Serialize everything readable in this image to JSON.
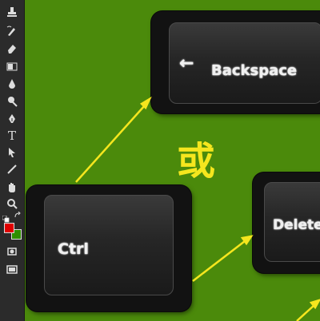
{
  "toolbar": {
    "tools": [
      {
        "icon": "stamp-icon"
      },
      {
        "icon": "history-brush-icon"
      },
      {
        "icon": "eraser-icon"
      },
      {
        "icon": "gradient-icon"
      },
      {
        "icon": "blur-icon"
      },
      {
        "icon": "dodge-icon"
      },
      {
        "icon": "pen-icon"
      },
      {
        "icon": "type-icon",
        "glyph": "T"
      },
      {
        "icon": "path-select-icon"
      },
      {
        "icon": "line-icon"
      },
      {
        "icon": "hand-icon"
      },
      {
        "icon": "zoom-icon"
      }
    ],
    "foreground_color": "#e00000",
    "background_color": "#2f8f00"
  },
  "canvas": {
    "background_color": "#4b8a0b",
    "keys": [
      {
        "name": "backspace",
        "label": "Backspace",
        "arrow_glyph": "←"
      },
      {
        "name": "ctrl",
        "label": "Ctrl"
      },
      {
        "name": "delete",
        "label": "Delete"
      }
    ],
    "or_text": "或",
    "arrow_color": "#f5e61e"
  }
}
